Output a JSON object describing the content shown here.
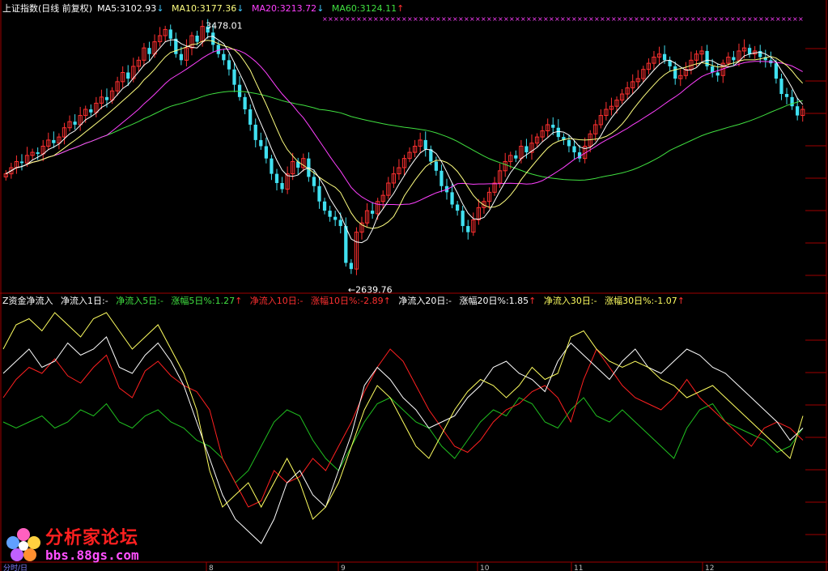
{
  "top_legend": {
    "title": "上证指数(日线 前复权)",
    "ma5": "MA5:3102.93",
    "ma10": "MA10:3177.36",
    "ma20": "MA20:3213.72",
    "ma60": "MA60:3124.11",
    "ma5_arrow": "↓",
    "ma10_arrow": "↓",
    "ma20_arrow": "↓",
    "ma60_arrow": "↑"
  },
  "bottom_legend": {
    "title": "Z资金净流入",
    "net1": "净流入1日:-",
    "net5": "净流入5日:-",
    "pct5": "涨幅5日%:1.27",
    "net10": "净流入10日:-",
    "pct10": "涨幅10日%:-2.89",
    "net20": "净流入20日:-",
    "pct20": "涨幅20日%:1.85",
    "net30": "净流入30日:-",
    "pct30": "涨幅30日%:-1.07",
    "arrow_up": "↑"
  },
  "annotations": {
    "high": "3478.01",
    "low": "2639.76"
  },
  "month_labels": [
    "8",
    "9",
    "10",
    "11",
    "12"
  ],
  "bottom_left_label": "分时/日",
  "logo": {
    "title": "分析家论坛",
    "url": "bbs.88gs.com"
  },
  "colors": {
    "up": "#ff3030",
    "down": "#40e0f0",
    "ma5": "#ffffff",
    "ma10": "#ffff80",
    "ma20": "#ff40ff",
    "ma60": "#40e040",
    "flow_red": "#ff2020",
    "flow_green": "#20c020",
    "flow_white": "#ffffff",
    "flow_yellow": "#ffff60",
    "grid": "#a00000"
  },
  "chart_data": {
    "type": "line",
    "price": {
      "high": 3478.01,
      "low": 2639.76,
      "close": [
        2990,
        3010,
        3030,
        3025,
        3050,
        3060,
        3055,
        3080,
        3100,
        3090,
        3110,
        3140,
        3160,
        3150,
        3180,
        3200,
        3190,
        3220,
        3240,
        3230,
        3260,
        3290,
        3320,
        3300,
        3340,
        3360,
        3400,
        3380,
        3420,
        3440,
        3460,
        3430,
        3380,
        3360,
        3400,
        3440,
        3420,
        3470,
        3450,
        3410,
        3380,
        3360,
        3330,
        3280,
        3240,
        3200,
        3150,
        3100,
        3080,
        3040,
        2990,
        2960,
        2940,
        2990,
        3030,
        3010,
        3040,
        2980,
        2950,
        2900,
        2870,
        2850,
        2840,
        2820,
        2700,
        2680,
        2800,
        2830,
        2870,
        2860,
        2900,
        2920,
        2960,
        2990,
        3010,
        3040,
        3060,
        3080,
        3100,
        3070,
        3030,
        3000,
        2950,
        2930,
        2890,
        2870,
        2820,
        2800,
        2840,
        2880,
        2900,
        2930,
        2960,
        3000,
        3030,
        3050,
        3040,
        3080,
        3060,
        3090,
        3110,
        3130,
        3150,
        3140,
        3110,
        3100,
        3080,
        3060,
        3040,
        3080,
        3120,
        3150,
        3180,
        3200,
        3210,
        3230,
        3250,
        3270,
        3290,
        3300,
        3330,
        3350,
        3370,
        3380,
        3360,
        3340,
        3300,
        3310,
        3330,
        3360,
        3380,
        3390,
        3340,
        3320,
        3310,
        3350,
        3370,
        3360,
        3390,
        3400,
        3380,
        3390,
        3370,
        3360,
        3350,
        3300,
        3250,
        3240,
        3210,
        3180,
        3200
      ]
    },
    "flow": {
      "red": [
        0.3,
        0.45,
        0.55,
        0.5,
        0.62,
        0.48,
        0.42,
        0.55,
        0.65,
        0.38,
        0.3,
        0.52,
        0.6,
        0.48,
        0.4,
        0.35,
        0.2,
        -0.2,
        -0.4,
        -0.6,
        -0.55,
        -0.3,
        -0.4,
        -0.35,
        -0.2,
        -0.3,
        -0.1,
        0.1,
        0.35,
        0.55,
        0.7,
        0.6,
        0.4,
        0.2,
        0.05,
        -0.1,
        -0.15,
        -0.05,
        0.1,
        0.2,
        0.25,
        0.35,
        0.4,
        0.3,
        0.1,
        0.45,
        0.7,
        0.55,
        0.4,
        0.3,
        0.25,
        0.2,
        0.3,
        0.45,
        0.3,
        0.2,
        0.1,
        0.0,
        -0.1,
        0.05,
        0.1,
        0.05,
        -0.05
      ],
      "green": [
        0.1,
        0.05,
        0.1,
        0.15,
        0.05,
        0.1,
        0.2,
        0.15,
        0.25,
        0.1,
        0.05,
        0.15,
        0.2,
        0.1,
        0.05,
        -0.05,
        -0.1,
        -0.2,
        -0.4,
        -0.3,
        -0.1,
        0.1,
        0.2,
        0.15,
        -0.05,
        -0.2,
        -0.3,
        -0.1,
        0.1,
        0.25,
        0.3,
        0.2,
        0.1,
        0.05,
        -0.1,
        -0.2,
        -0.05,
        0.1,
        0.2,
        0.15,
        0.3,
        0.25,
        0.1,
        0.05,
        0.2,
        0.3,
        0.15,
        0.1,
        0.2,
        0.1,
        0.0,
        -0.1,
        -0.2,
        0.05,
        0.2,
        0.25,
        0.1,
        0.05,
        0.0,
        -0.05,
        -0.15,
        -0.1,
        0.05
      ],
      "white": [
        0.5,
        0.6,
        0.7,
        0.55,
        0.6,
        0.75,
        0.65,
        0.7,
        0.8,
        0.55,
        0.5,
        0.65,
        0.75,
        0.6,
        0.4,
        0.1,
        -0.2,
        -0.5,
        -0.7,
        -0.8,
        -0.9,
        -0.7,
        -0.4,
        -0.3,
        -0.5,
        -0.6,
        -0.3,
        0.0,
        0.4,
        0.55,
        0.45,
        0.3,
        0.2,
        0.05,
        0.1,
        0.15,
        0.3,
        0.4,
        0.55,
        0.6,
        0.5,
        0.45,
        0.35,
        0.6,
        0.75,
        0.65,
        0.55,
        0.45,
        0.6,
        0.7,
        0.55,
        0.5,
        0.6,
        0.7,
        0.65,
        0.55,
        0.5,
        0.4,
        0.3,
        0.2,
        0.1,
        -0.05,
        0.05
      ],
      "yellow": [
        0.7,
        0.9,
        0.95,
        0.85,
        1.0,
        0.9,
        0.8,
        0.95,
        1.0,
        0.85,
        0.7,
        0.8,
        0.9,
        0.7,
        0.5,
        0.2,
        -0.3,
        -0.6,
        -0.5,
        -0.4,
        -0.6,
        -0.4,
        -0.2,
        -0.4,
        -0.7,
        -0.6,
        -0.4,
        -0.1,
        0.2,
        0.4,
        0.3,
        0.1,
        -0.1,
        -0.2,
        0.0,
        0.2,
        0.35,
        0.45,
        0.4,
        0.3,
        0.4,
        0.55,
        0.45,
        0.5,
        0.8,
        0.85,
        0.7,
        0.6,
        0.55,
        0.6,
        0.55,
        0.45,
        0.4,
        0.3,
        0.35,
        0.4,
        0.3,
        0.2,
        0.1,
        0.0,
        -0.1,
        -0.2,
        0.15
      ]
    }
  }
}
